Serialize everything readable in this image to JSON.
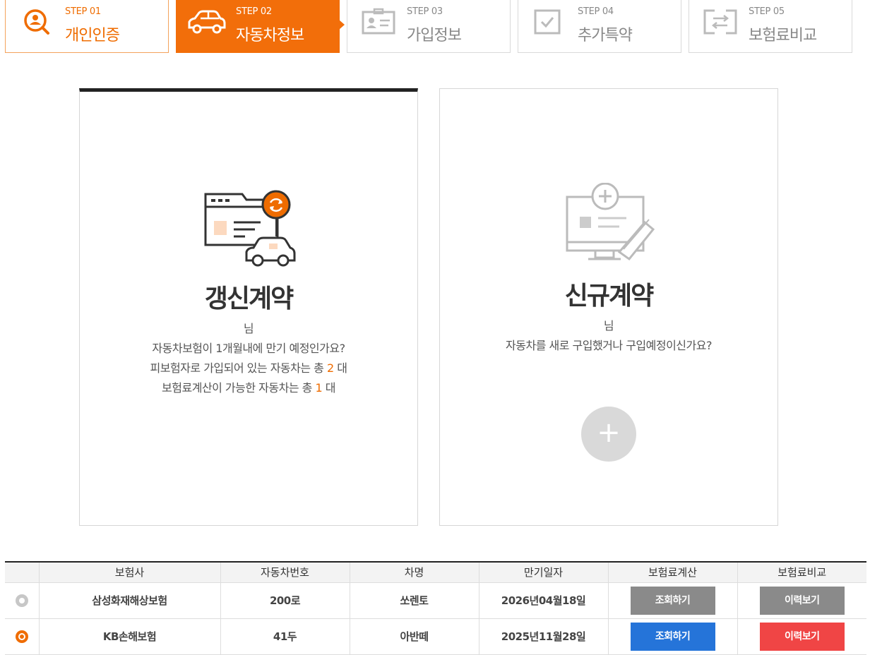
{
  "steps": [
    {
      "num": "STEP 01",
      "label": "개인인증",
      "icon": "person-search-icon",
      "state": "done"
    },
    {
      "num": "STEP 02",
      "label": "자동차정보",
      "icon": "car-icon",
      "state": "active"
    },
    {
      "num": "STEP 03",
      "label": "가입정보",
      "icon": "id-card-icon",
      "state": "todo"
    },
    {
      "num": "STEP 04",
      "label": "추가특약",
      "icon": "checkbox-icon",
      "state": "todo"
    },
    {
      "num": "STEP 05",
      "label": "보험료비교",
      "icon": "compare-arrows-icon",
      "state": "todo"
    }
  ],
  "renewal": {
    "title": "갱신계약",
    "name_suffix": "님",
    "line1": "자동차보험이 1개월내에 만기 예정인가요?",
    "line2_pre": "피보험자로 가입되어 있는 자동차는 총 ",
    "line2_count": "2",
    "line2_post": " 대",
    "line3_pre": "보험료계산이 가능한 자동차는 총 ",
    "line3_count": "1",
    "line3_post": " 대"
  },
  "newcontract": {
    "title": "신규계약",
    "name_suffix": "님",
    "line1": "자동차를 새로 구입했거나 구입예정이신가요?",
    "plus": "+"
  },
  "table": {
    "headers": [
      "",
      "보험사",
      "자동차번호",
      "차명",
      "만기일자",
      "보험료계산",
      "보험료비교"
    ],
    "rows": [
      {
        "selected": false,
        "insurer": "삼성화재해상보험",
        "plate": "200로",
        "car": "쏘렌토",
        "expiry": "2026년04월18일",
        "calc": "조회하기",
        "compare": "이력보기",
        "calc_color": "gray",
        "compare_color": "gray"
      },
      {
        "selected": true,
        "insurer": "KB손해보험",
        "plate": "41두",
        "car": "아반떼",
        "expiry": "2025년11월28일",
        "calc": "조회하기",
        "compare": "이력보기",
        "calc_color": "blue",
        "compare_color": "red"
      }
    ]
  },
  "colors": {
    "accent": "#f26e0a",
    "blue": "#2574d9",
    "red": "#f04545",
    "gray": "#8a8a8a"
  }
}
